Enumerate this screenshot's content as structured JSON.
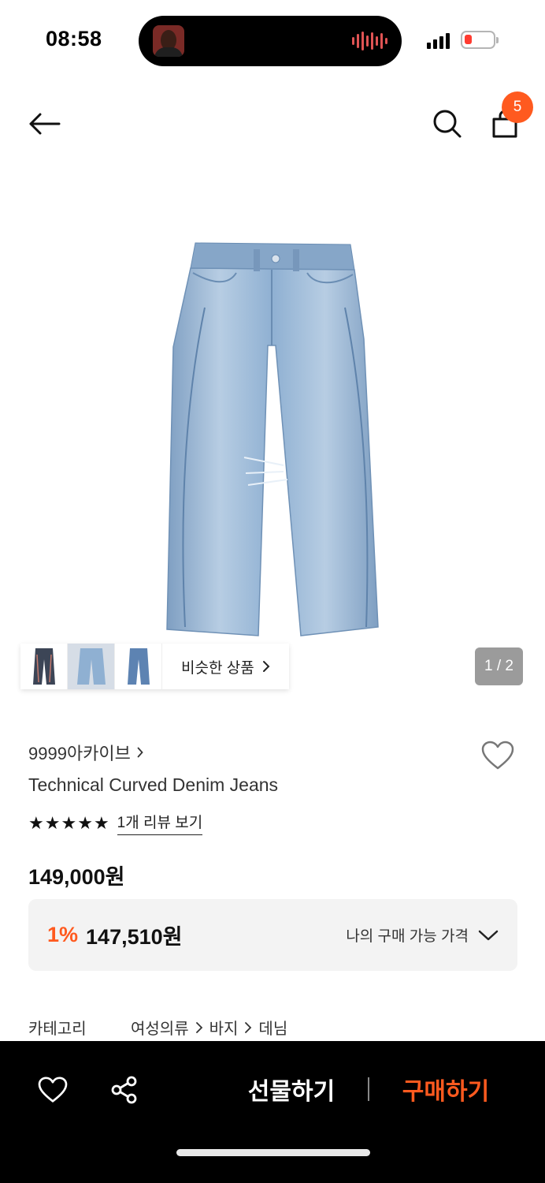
{
  "status_bar": {
    "time": "08:58"
  },
  "header": {
    "cart_count": "5"
  },
  "gallery": {
    "similar_label": "비슷한 상품",
    "page_indicator": "1 / 2"
  },
  "product": {
    "brand": "9999아카이브",
    "name": "Technical Curved Denim Jeans",
    "rating_stars": 5,
    "review_link": "1개 리뷰 보기",
    "price": "149,000원",
    "discount_rate": "1%",
    "discount_price": "147,510원",
    "my_price_label": "나의 구매 가능 가격"
  },
  "category": {
    "label": "카테고리",
    "path": [
      "여성의류",
      "바지",
      "데님"
    ]
  },
  "bottom_bar": {
    "gift_label": "선물하기",
    "buy_label": "구매하기"
  },
  "colors": {
    "accent": "#ff5a1f",
    "denim": "#9fbedb"
  }
}
